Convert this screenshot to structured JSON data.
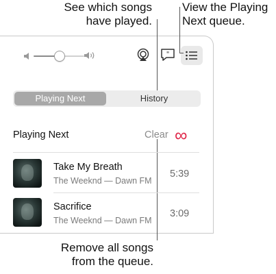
{
  "callouts": {
    "history": "See which songs\nhave played.",
    "history_line1": "See which songs",
    "history_line2": "have played.",
    "queue_line1": "View the Playing",
    "queue_line2": "Next queue.",
    "clear_line1": "Remove all songs",
    "clear_line2": "from the queue."
  },
  "toolbar": {
    "volume_level": 0.5,
    "icons": [
      "volume-low-icon",
      "volume-high-icon",
      "airplay-icon",
      "lyrics-icon",
      "queue-list-icon"
    ]
  },
  "tabs": {
    "playing_next": "Playing Next",
    "history": "History",
    "selected": "playing_next"
  },
  "section": {
    "title": "Playing Next",
    "clear_label": "Clear",
    "infinity_symbol": "∞",
    "accent_color": "#e0284a"
  },
  "tracks": [
    {
      "title": "Take My Breath",
      "artist": "The Weeknd — Dawn FM",
      "duration": "5:39"
    },
    {
      "title": "Sacrifice",
      "artist": "The Weeknd — Dawn FM",
      "duration": "3:09"
    }
  ]
}
